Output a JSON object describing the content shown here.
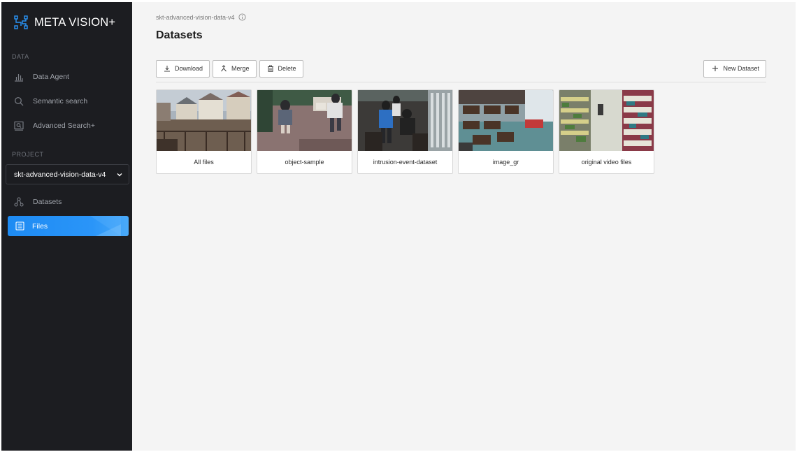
{
  "app": {
    "title": "META VISION+"
  },
  "sidebar": {
    "data_section_label": "DATA",
    "data_items": [
      {
        "label": "Data Agent",
        "icon": "bar-chart-icon"
      },
      {
        "label": "Semantic search",
        "icon": "search-icon"
      },
      {
        "label": "Advanced Search+",
        "icon": "image-search-icon"
      }
    ],
    "project_section_label": "PROJECT",
    "project_selected": "skt-advanced-vision-data-v4",
    "project_items": [
      {
        "label": "Datasets",
        "icon": "datasets-icon"
      },
      {
        "label": "Files",
        "icon": "files-icon",
        "active": true
      }
    ]
  },
  "header": {
    "breadcrumb": "skt-advanced-vision-data-v4",
    "title": "Datasets"
  },
  "toolbar": {
    "download_label": "Download",
    "merge_label": "Merge",
    "delete_label": "Delete",
    "new_dataset_label": "New Dataset"
  },
  "datasets": [
    {
      "name": "All files"
    },
    {
      "name": "object-sample"
    },
    {
      "name": "intrusion-event-dataset"
    },
    {
      "name": "image_gr"
    },
    {
      "name": "original video files"
    }
  ],
  "colors": {
    "sidebar_bg": "#1c1d21",
    "accent": "#1e8bf3",
    "main_bg": "#f4f4f4"
  }
}
